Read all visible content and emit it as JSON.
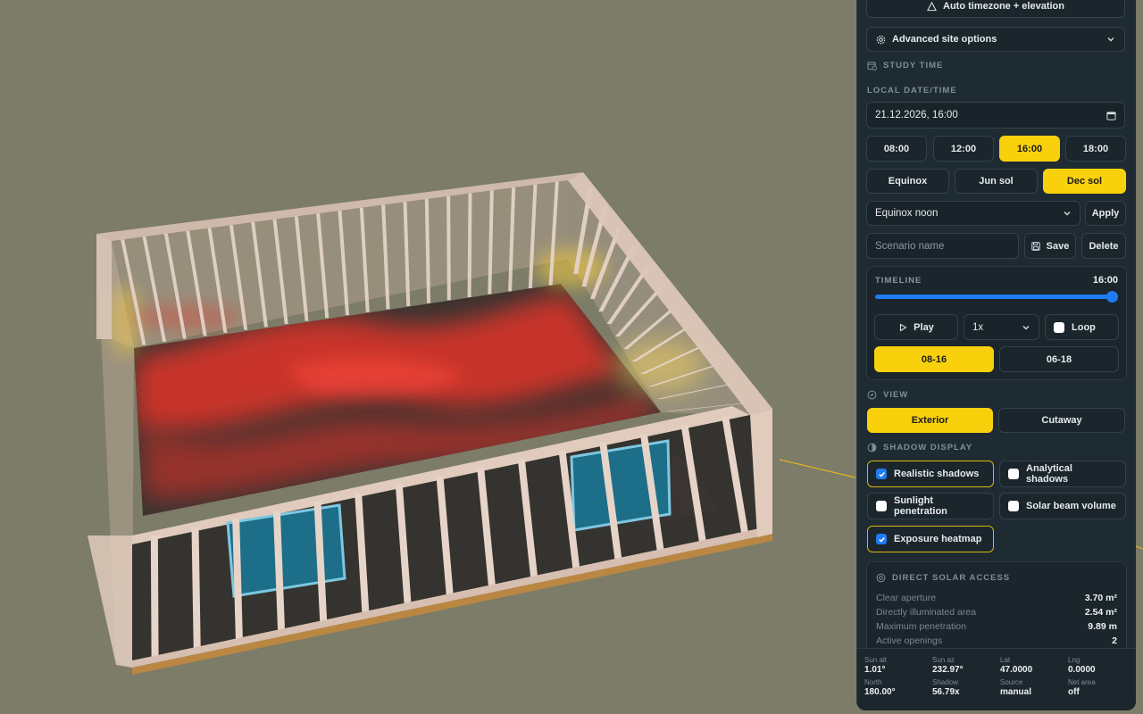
{
  "site": {
    "auto_button": "Auto timezone + elevation",
    "advanced_label": "Advanced site options"
  },
  "study_time": {
    "section_label": "STUDY TIME",
    "datetime_label": "LOCAL DATE/TIME",
    "datetime_value": "21.12.2026, 16:00",
    "hour_presets": [
      {
        "label": "08:00",
        "active": false
      },
      {
        "label": "12:00",
        "active": false
      },
      {
        "label": "16:00",
        "active": true
      },
      {
        "label": "18:00",
        "active": false
      }
    ],
    "season_presets": [
      {
        "label": "Equinox",
        "active": false
      },
      {
        "label": "Jun sol",
        "active": false
      },
      {
        "label": "Dec sol",
        "active": true
      }
    ],
    "scenario_select": "Equinox noon",
    "apply_label": "Apply",
    "scenario_placeholder": "Scenario name",
    "save_label": "Save",
    "delete_label": "Delete"
  },
  "timeline": {
    "label": "TIMELINE",
    "value": "16:00",
    "position": 1.0,
    "play_label": "Play",
    "speed": "1x",
    "loop_label": "Loop",
    "loop_checked": false,
    "ranges": [
      {
        "label": "08-16",
        "active": true
      },
      {
        "label": "06-18",
        "active": false
      }
    ]
  },
  "view": {
    "section_label": "VIEW",
    "options": [
      {
        "label": "Exterior",
        "active": true
      },
      {
        "label": "Cutaway",
        "active": false
      }
    ]
  },
  "shadow_display": {
    "section_label": "SHADOW DISPLAY",
    "options": [
      {
        "label": "Realistic shadows",
        "checked": true
      },
      {
        "label": "Analytical shadows",
        "checked": false
      },
      {
        "label": "Sunlight penetration",
        "checked": false
      },
      {
        "label": "Solar beam volume",
        "checked": false
      },
      {
        "label": "Exposure heatmap",
        "checked": true
      }
    ]
  },
  "solar_access": {
    "section_label": "DIRECT SOLAR ACCESS",
    "rows": [
      {
        "label": "Clear aperture",
        "value": "3.70 m²"
      },
      {
        "label": "Directly illuminated area",
        "value": "2.54 m²"
      },
      {
        "label": "Maximum penetration",
        "value": "9.89 m"
      },
      {
        "label": "Active openings",
        "value": "2"
      }
    ]
  },
  "footer": {
    "cells": [
      {
        "label": "Sun alt",
        "value": "1.01°"
      },
      {
        "label": "Sun az",
        "value": "232.97°"
      },
      {
        "label": "Lat",
        "value": "47.0000"
      },
      {
        "label": "Lng",
        "value": "0.0000"
      },
      {
        "label": "North",
        "value": "180.00°"
      },
      {
        "label": "Shadow",
        "value": "56.79x"
      },
      {
        "label": "Source",
        "value": "manual"
      },
      {
        "label": "Net area",
        "value": "off"
      }
    ]
  },
  "colors": {
    "accent": "#f8d10c",
    "panel_bg": "#1f2b33",
    "scene_bg": "#7c7c68",
    "checkbox_on": "#1f7bf2"
  }
}
